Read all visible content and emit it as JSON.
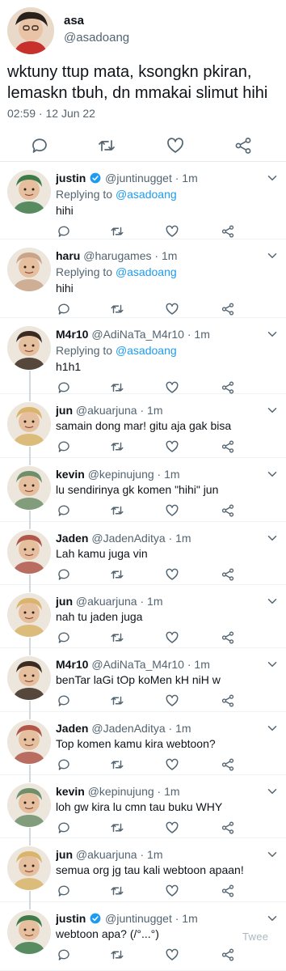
{
  "main_tweet": {
    "display_name": "asa",
    "handle": "@asadoang",
    "text": "wktuny ttup mata, ksongkn pkiran, lemaskn tbuh, dn mmakai slimut hihi",
    "timestamp": "02:59 · 12 Jun 22"
  },
  "replying_label": "Replying to",
  "replies": [
    {
      "name": "justin",
      "verified": true,
      "handle": "@juntinugget",
      "time": "1m",
      "replying_to": "@asadoang",
      "text": "hihi",
      "avatar_color": "#3f7a4a"
    },
    {
      "name": "haru",
      "verified": false,
      "handle": "@harugames",
      "time": "1m",
      "replying_to": "@asadoang",
      "text": "hihi",
      "avatar_color": "#c9a488"
    },
    {
      "name": "M4r10",
      "verified": false,
      "handle": "@AdiNaTa_M4r10",
      "time": "1m",
      "replying_to": "@asadoang",
      "text": "h1h1",
      "avatar_color": "#3b2a20"
    },
    {
      "name": "jun",
      "verified": false,
      "handle": "@akuarjuna",
      "time": "1m",
      "text": "samain dong mar! gitu aja gak bisa",
      "avatar_color": "#d9b46a"
    },
    {
      "name": "kevin",
      "verified": false,
      "handle": "@kepinujung",
      "time": "1m",
      "text": "lu sendirinya gk komen \"hihi\" jun",
      "avatar_color": "#6f8f6a"
    },
    {
      "name": "Jaden",
      "verified": false,
      "handle": "@JadenAditya",
      "time": "1m",
      "text": "Lah kamu juga vin",
      "avatar_color": "#b0574a"
    },
    {
      "name": "jun",
      "verified": false,
      "handle": "@akuarjuna",
      "time": "1m",
      "text": "nah tu jaden juga",
      "avatar_color": "#d9b46a"
    },
    {
      "name": "M4r10",
      "verified": false,
      "handle": "@AdiNaTa_M4r10",
      "time": "1m",
      "text": "benTar laGi tOp koMen kH niH w",
      "avatar_color": "#3b2a20"
    },
    {
      "name": "Jaden",
      "verified": false,
      "handle": "@JadenAditya",
      "time": "1m",
      "text": "Top komen kamu kira webtoon?",
      "avatar_color": "#b0574a"
    },
    {
      "name": "kevin",
      "verified": false,
      "handle": "@kepinujung",
      "time": "1m",
      "text": "loh gw kira lu cmn tau buku WHY",
      "avatar_color": "#6f8f6a"
    },
    {
      "name": "jun",
      "verified": false,
      "handle": "@akuarjuna",
      "time": "1m",
      "text": "semua org jg tau kali webtoon apaan!",
      "avatar_color": "#d9b46a"
    },
    {
      "name": "justin",
      "verified": true,
      "handle": "@juntinugget",
      "time": "1m",
      "text": "webtoon apa? (/°...°)",
      "avatar_color": "#3f7a4a"
    }
  ],
  "tweet_button_label": "Twee",
  "colors": {
    "text": "#0f1419",
    "secondary": "#536471",
    "accent": "#1d9bf0",
    "divider": "#eff3f4"
  },
  "icons": {
    "reply": "reply-icon",
    "retweet": "retweet-icon",
    "like": "heart-icon",
    "share": "share-icon",
    "more": "chevron-down-icon",
    "verified": "verified-badge-icon"
  }
}
